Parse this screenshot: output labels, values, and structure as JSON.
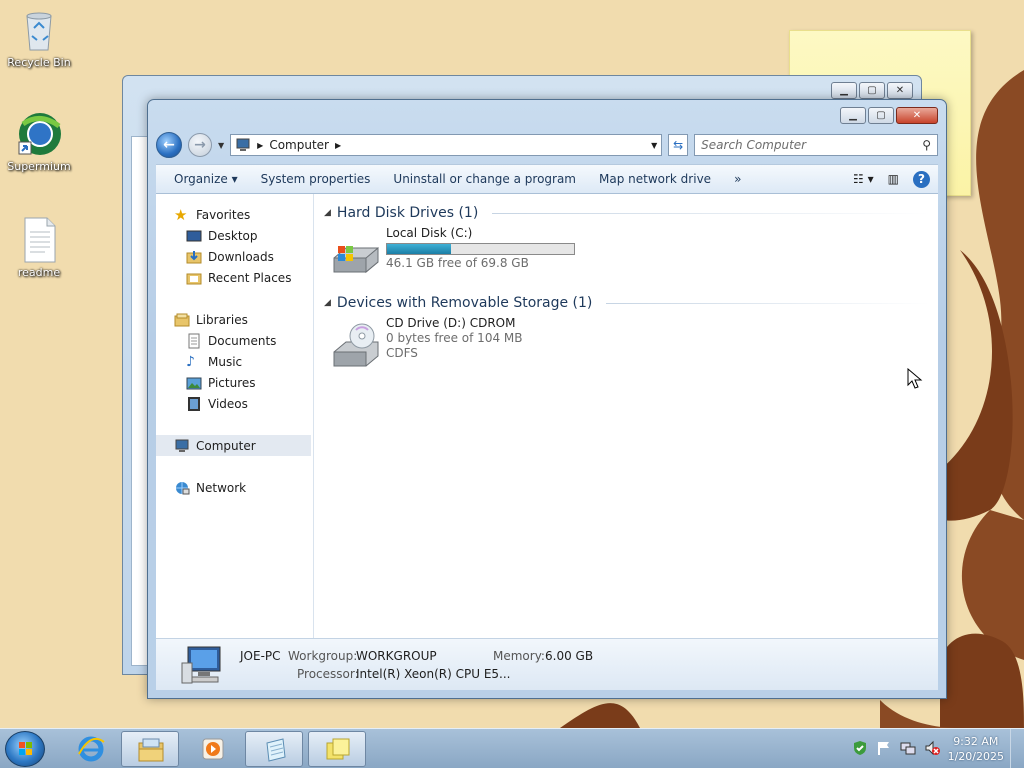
{
  "desktop": {
    "icons": [
      {
        "label": "Recycle Bin",
        "icon": "recycle-bin-icon"
      },
      {
        "label": "Supermium",
        "icon": "supermium-icon"
      },
      {
        "label": "readme",
        "icon": "text-file-icon"
      }
    ]
  },
  "window": {
    "address": {
      "crumb": "Computer"
    },
    "search": {
      "placeholder": "Search Computer"
    },
    "toolbar": {
      "organize": "Organize",
      "system_properties": "System properties",
      "uninstall": "Uninstall or change a program",
      "map_drive": "Map network drive",
      "more": "»"
    },
    "nav": {
      "favorites": "Favorites",
      "desktop": "Desktop",
      "downloads": "Downloads",
      "recent": "Recent Places",
      "libraries": "Libraries",
      "documents": "Documents",
      "music": "Music",
      "pictures": "Pictures",
      "videos": "Videos",
      "computer": "Computer",
      "network": "Network"
    },
    "groups": {
      "hdd": {
        "title": "Hard Disk Drives (1)",
        "drive_name": "Local Disk (C:)",
        "free_text": "46.1 GB free of 69.8 GB",
        "used_fraction": 0.34
      },
      "removable": {
        "title": "Devices with Removable Storage (1)",
        "drive_name": "CD Drive (D:) CDROM",
        "free_text": "0 bytes free of 104 MB",
        "fs": "CDFS"
      }
    },
    "details": {
      "pc_name": "JOE-PC",
      "workgroup_label": "Workgroup:",
      "workgroup": "WORKGROUP",
      "memory_label": "Memory:",
      "memory": "6.00 GB",
      "processor_label": "Processor:",
      "processor": "Intel(R) Xeon(R) CPU E5..."
    }
  },
  "taskbar": {
    "time": "9:32 AM",
    "date": "1/20/2025"
  },
  "colors": {
    "accent": "#2a6fc1",
    "disk_bar": "#1b7ea6",
    "wallpaper": "#f1dcae",
    "wallpaper_swirl": "#8a4a24"
  }
}
